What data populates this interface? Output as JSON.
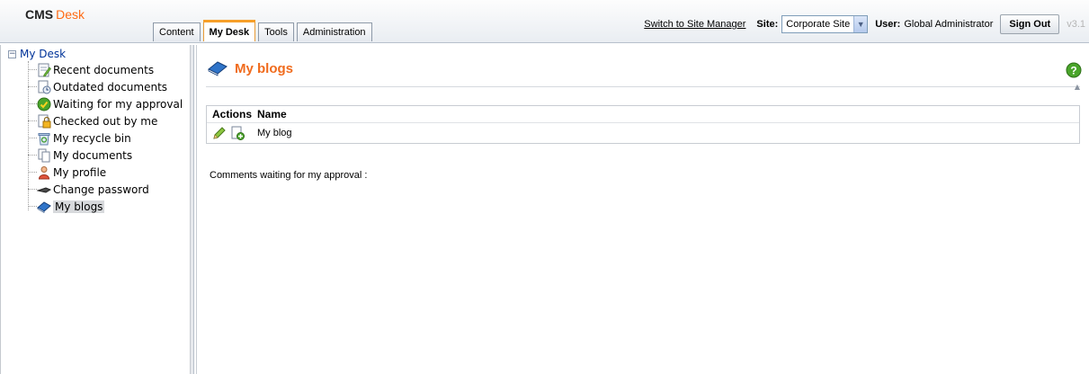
{
  "header": {
    "logo_cms": "CMS",
    "logo_desk": "Desk",
    "tabs": [
      {
        "label": "Content",
        "active": false
      },
      {
        "label": "My Desk",
        "active": true
      },
      {
        "label": "Tools",
        "active": false
      },
      {
        "label": "Administration",
        "active": false
      }
    ],
    "switch_link": "Switch to Site Manager",
    "site_label": "Site:",
    "site_value": "Corporate Site",
    "user_label": "User:",
    "user_name": "Global Administrator",
    "signout_label": "Sign Out",
    "version": "v3.1"
  },
  "tree": {
    "root_label": "My Desk",
    "items": [
      {
        "label": "Recent documents",
        "icon": "recent-documents-icon"
      },
      {
        "label": "Outdated documents",
        "icon": "outdated-documents-icon"
      },
      {
        "label": "Waiting for my approval",
        "icon": "approval-check-icon"
      },
      {
        "label": "Checked out by me",
        "icon": "checked-out-lock-icon"
      },
      {
        "label": "My recycle bin",
        "icon": "recycle-bin-icon"
      },
      {
        "label": "My documents",
        "icon": "documents-icon"
      },
      {
        "label": "My profile",
        "icon": "user-profile-icon"
      },
      {
        "label": "Change password",
        "icon": "key-icon"
      },
      {
        "label": "My blogs",
        "icon": "blog-book-icon",
        "selected": true
      }
    ]
  },
  "main": {
    "title": "My blogs",
    "grid": {
      "columns": [
        "Actions",
        "Name"
      ],
      "rows": [
        {
          "name": "My blog",
          "actions": [
            "edit-pencil-icon",
            "new-document-icon"
          ]
        }
      ]
    },
    "comments_label": "Comments waiting for my approval :"
  },
  "colors": {
    "accent_orange": "#f06b1d",
    "tree_root_blue": "#003399",
    "selected_bg": "#d7d9dc"
  }
}
